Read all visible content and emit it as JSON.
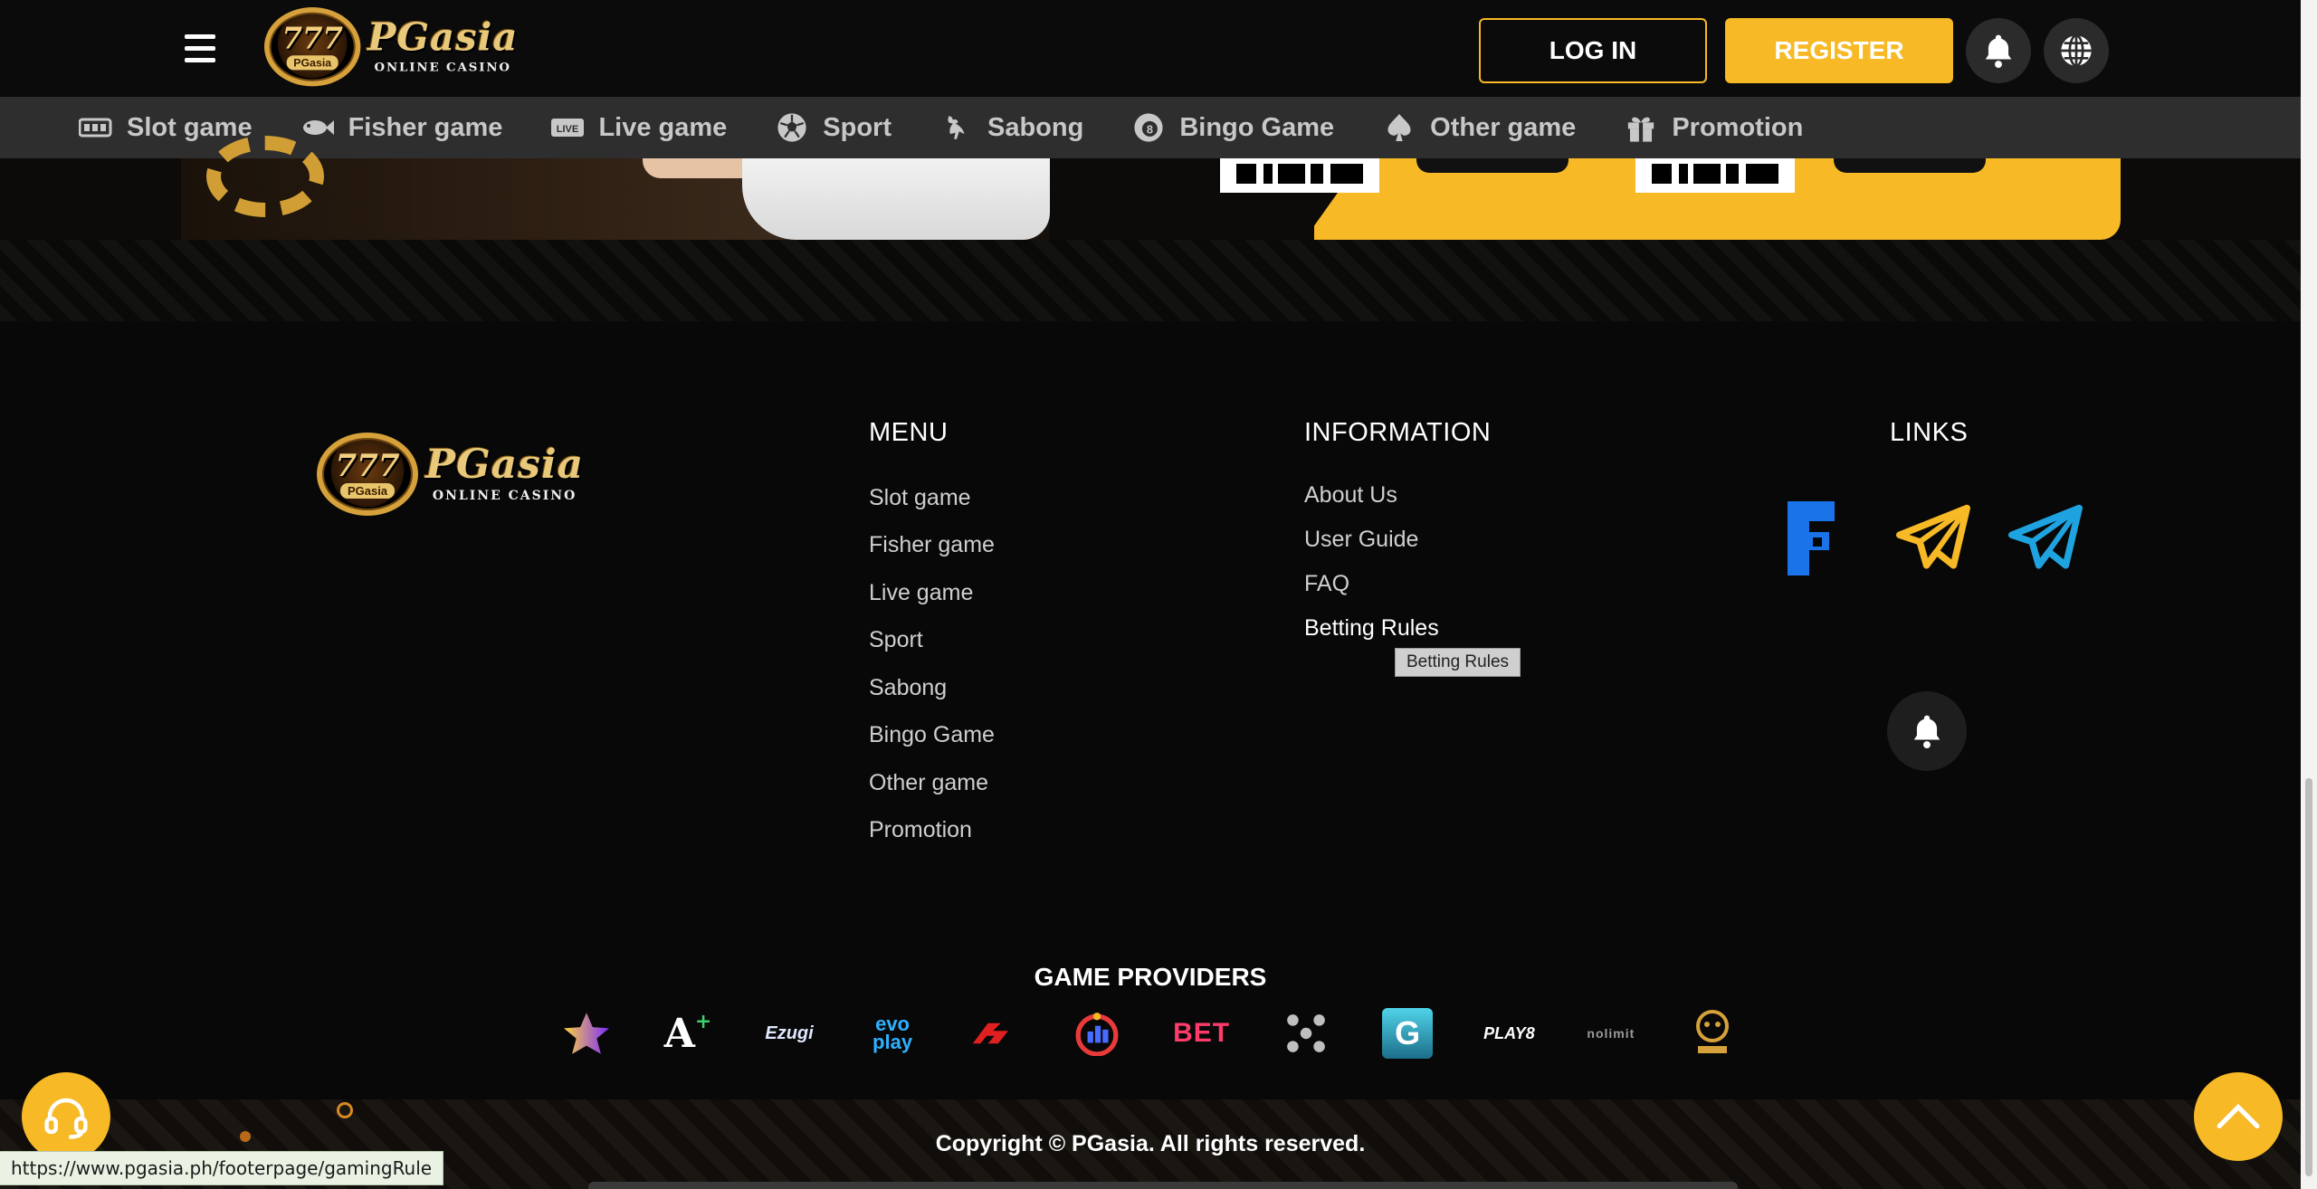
{
  "header": {
    "logo": {
      "badge_number": "777",
      "badge_text": "PGasia",
      "brand": "PGasia",
      "tagline": "ONLINE CASINO"
    },
    "login_label": "LOG IN",
    "register_label": "REGISTER"
  },
  "nav": {
    "items": [
      {
        "label": "Slot game",
        "icon": "slot-machine-icon"
      },
      {
        "label": "Fisher game",
        "icon": "fish-icon"
      },
      {
        "label": "Live game",
        "icon": "live-icon"
      },
      {
        "label": "Sport",
        "icon": "soccer-ball-icon"
      },
      {
        "label": "Sabong",
        "icon": "rooster-icon"
      },
      {
        "label": "Bingo Game",
        "icon": "bingo-ball-icon"
      },
      {
        "label": "Other game",
        "icon": "spade-icon"
      },
      {
        "label": "Promotion",
        "icon": "gift-icon"
      }
    ]
  },
  "footer": {
    "menu": {
      "title": "MENU",
      "items": [
        "Slot game",
        "Fisher game",
        "Live game",
        "Sport",
        "Sabong",
        "Bingo Game",
        "Other game",
        "Promotion"
      ]
    },
    "information": {
      "title": "INFORMATION",
      "items": [
        "About Us",
        "User Guide",
        "FAQ",
        "Betting Rules"
      ],
      "tooltip": "Betting Rules"
    },
    "links": {
      "title": "LINKS",
      "social": [
        "f-logo-icon",
        "telegram-outline-yellow-icon",
        "telegram-outline-blue-icon"
      ]
    },
    "providers": {
      "title": "GAME PROVIDERS",
      "items": [
        {
          "name": "star-provider-logo",
          "text": ""
        },
        {
          "name": "a-plus-provider-logo",
          "text": "A"
        },
        {
          "name": "ezugi-logo",
          "text": "Ezugi"
        },
        {
          "name": "evoplay-logo",
          "text": "evo play"
        },
        {
          "name": "red-logo",
          "text": ""
        },
        {
          "name": "jili-logo",
          "text": ""
        },
        {
          "name": "betconstruct-logo",
          "text": "BET"
        },
        {
          "name": "dots-logo",
          "text": ""
        },
        {
          "name": "g-logo",
          "text": "G"
        },
        {
          "name": "play8-logo",
          "text": "PLAY8"
        },
        {
          "name": "nolimit-logo",
          "text": "nolimit"
        },
        {
          "name": "fb-games-logo",
          "text": ""
        }
      ]
    },
    "copyright": "Copyright © PGasia. All rights reserved."
  },
  "status_url": "https://www.pgasia.ph/footerpage/gamingRule",
  "colors": {
    "accent": "#f7b925",
    "background": "#080808",
    "nav_bg": "#2e2e2e",
    "telegram_blue": "#1fa3e0",
    "f_blue": "#1a73e8"
  }
}
